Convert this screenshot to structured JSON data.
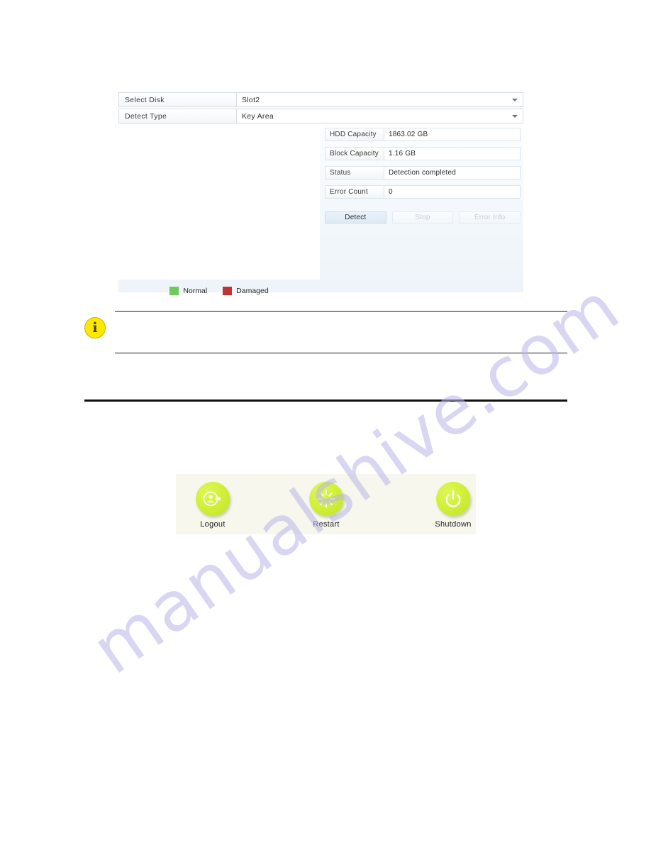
{
  "document": {
    "watermark": "manualshive.com"
  },
  "hdd_detect_dialog": {
    "fields": [
      {
        "label": "Select Disk",
        "value": "Slot2",
        "icon": "chevron-down-icon"
      },
      {
        "label": "Detect Type",
        "value": "Key Area",
        "icon": "chevron-down-icon"
      }
    ],
    "info_table": [
      {
        "key": "HDD Capacity",
        "value": "1863.02 GB"
      },
      {
        "key": "Block Capacity",
        "value": "1.16 GB"
      },
      {
        "key": "Status",
        "value": "Detection completed"
      },
      {
        "key": "Error Count",
        "value": "0"
      }
    ],
    "buttons": [
      {
        "label": "Detect",
        "state": "enabled"
      },
      {
        "label": "Stop",
        "state": "disabled"
      },
      {
        "label": "Error Info",
        "state": "disabled"
      }
    ],
    "legend": [
      {
        "label": "Normal",
        "color": "#6ec95f"
      },
      {
        "label": "Damaged",
        "color": "#c23434"
      }
    ],
    "grid": {
      "block_color": "#6ec95f",
      "gridline_color": "#ffffff",
      "columns": 14,
      "rows": 11
    }
  },
  "note": {
    "icon": "info-icon",
    "icon_glyph": "i",
    "icon_color": "#ffe800",
    "text": ""
  },
  "shutdown_menu": {
    "background": "#f7f7ee",
    "items": [
      {
        "label": "Logout",
        "icon": "logout-icon"
      },
      {
        "label": "Restart",
        "icon": "restart-icon"
      },
      {
        "label": "Shutdown",
        "icon": "power-icon"
      }
    ]
  }
}
